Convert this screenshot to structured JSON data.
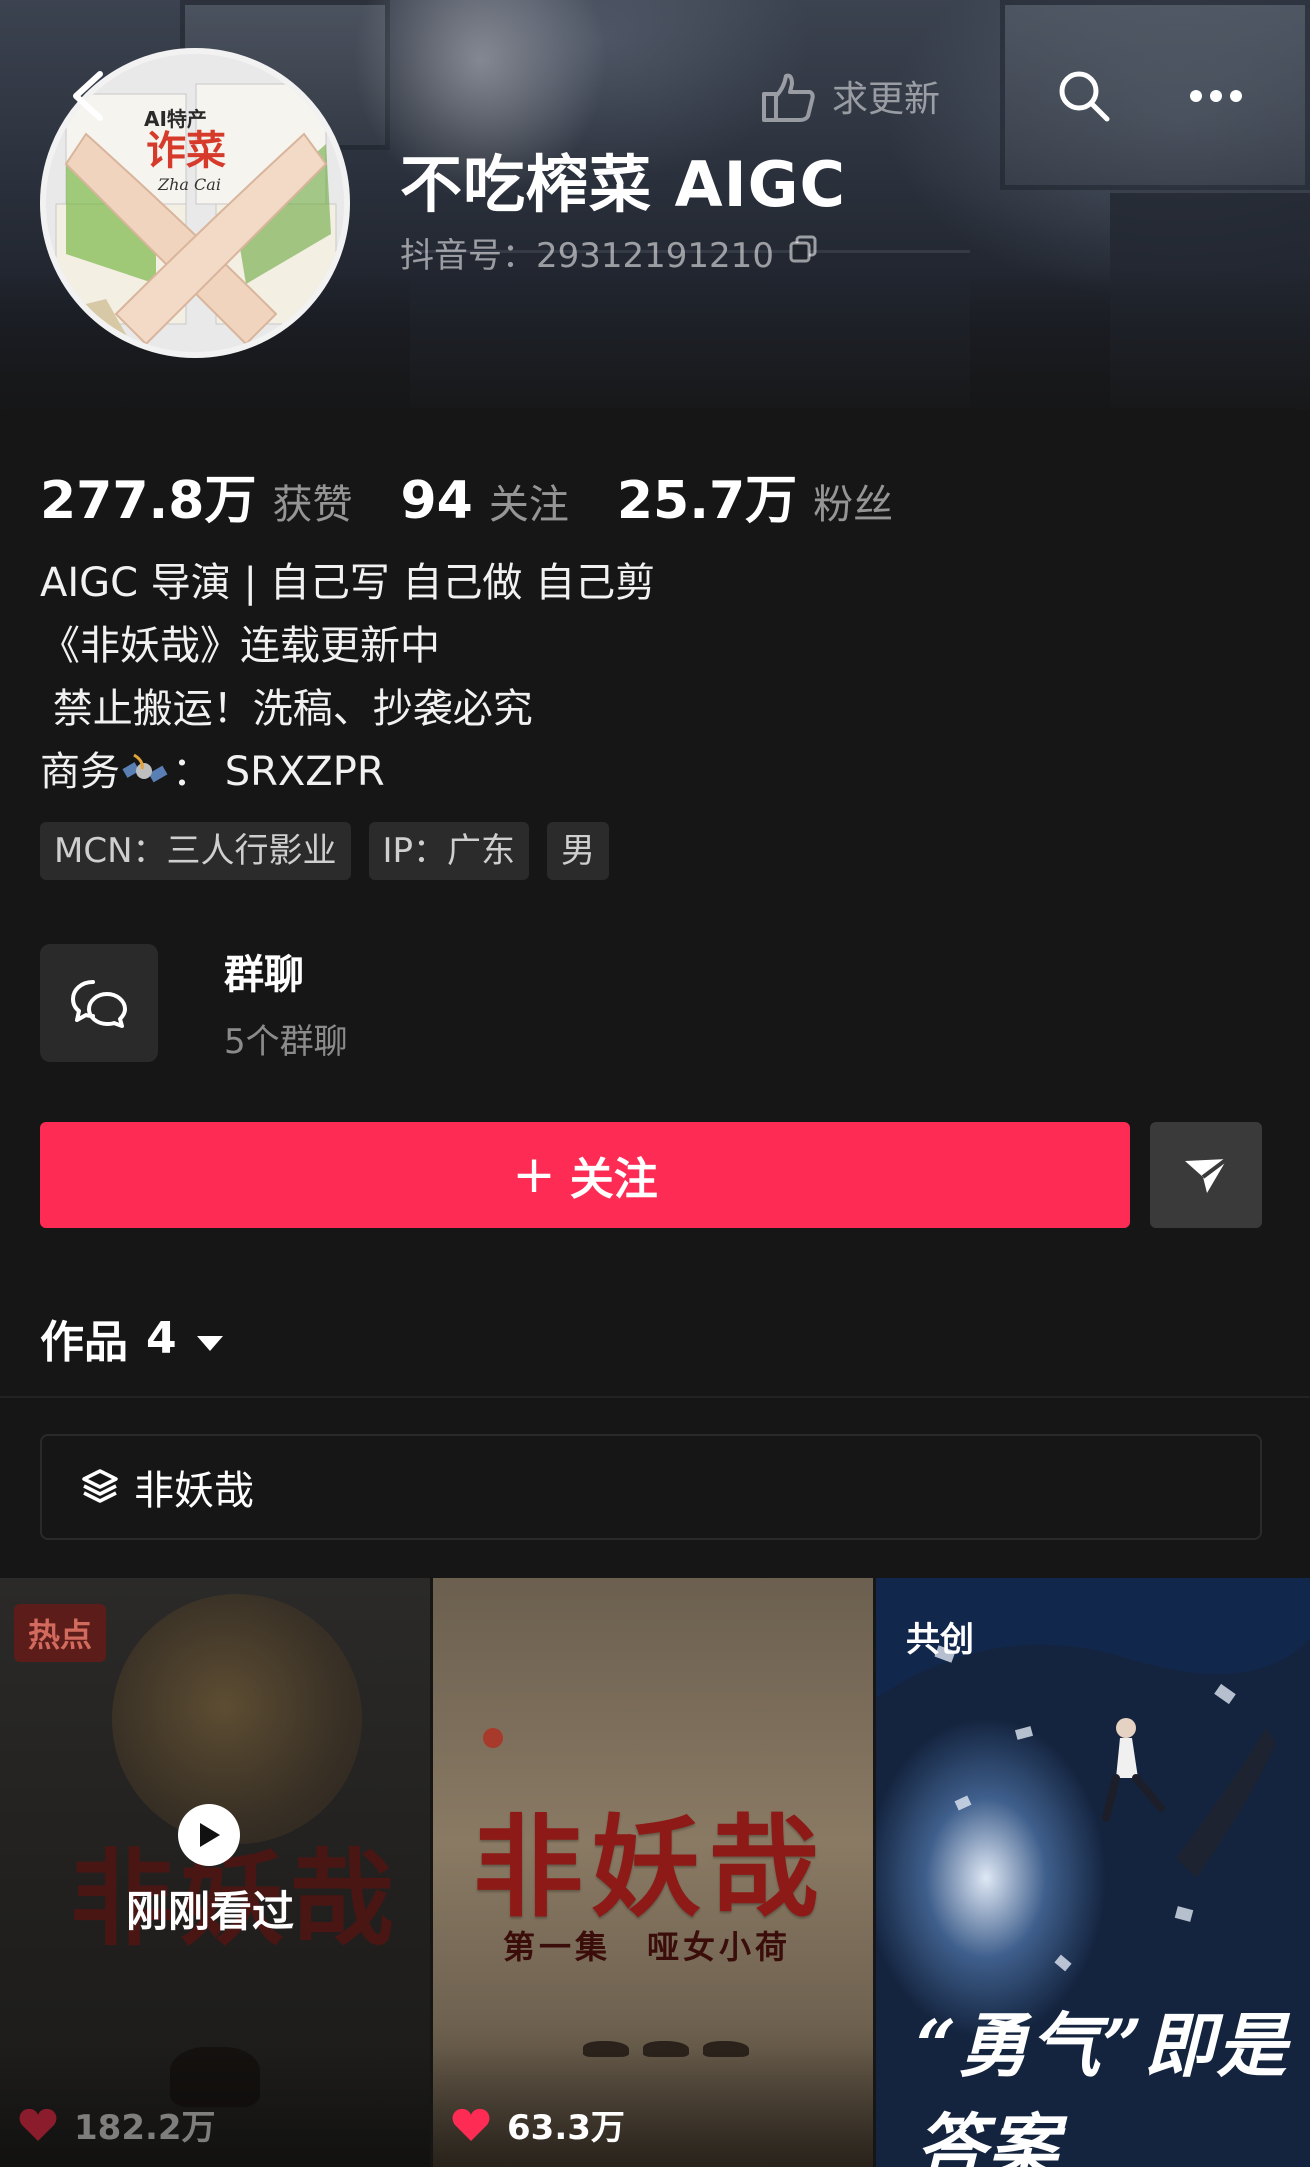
{
  "header": {
    "name": "不吃榨菜 AIGC",
    "douyin_id": "抖音号：29312191210",
    "request_update_label": "求更新",
    "avatar_text": {
      "line1": "AI特产",
      "line2": "诈菜",
      "line3": "Zha Cai"
    }
  },
  "stats": [
    {
      "num": "277.8万",
      "label": "获赞"
    },
    {
      "num": "94",
      "label": "关注"
    },
    {
      "num": "25.7万",
      "label": "粉丝"
    }
  ],
  "bio": {
    "line1": "AIGC 导演 | 自己写 自己做 自己剪",
    "line2": "《非妖哉》连载更新中",
    "line3": " 禁止搬运！洗稿、抄袭必究",
    "line4_prefix": "商务",
    "line4_suffix": "： SRXZPR"
  },
  "tags": [
    "MCN：三人行影业",
    "IP：广东",
    "男"
  ],
  "group_chat": {
    "title": "群聊",
    "subtitle": "5个群聊"
  },
  "follow_button": {
    "label": "关注"
  },
  "works": {
    "label": "作品",
    "count": "4"
  },
  "collection": {
    "label": "非妖哉"
  },
  "videos": [
    {
      "badge": "热点",
      "title_art": "非妖哉",
      "overlay": "刚刚看过",
      "likes": "182.2万"
    },
    {
      "title_art": "非妖哉",
      "subtitle_art": "第一集　哑女小荷",
      "likes": "63.3万"
    },
    {
      "badge": "共创",
      "title_art": "“勇气”即是答案"
    }
  ],
  "colors": {
    "accent": "#fe2c55",
    "background": "#161616",
    "tag_bg": "#2b2b2b"
  }
}
